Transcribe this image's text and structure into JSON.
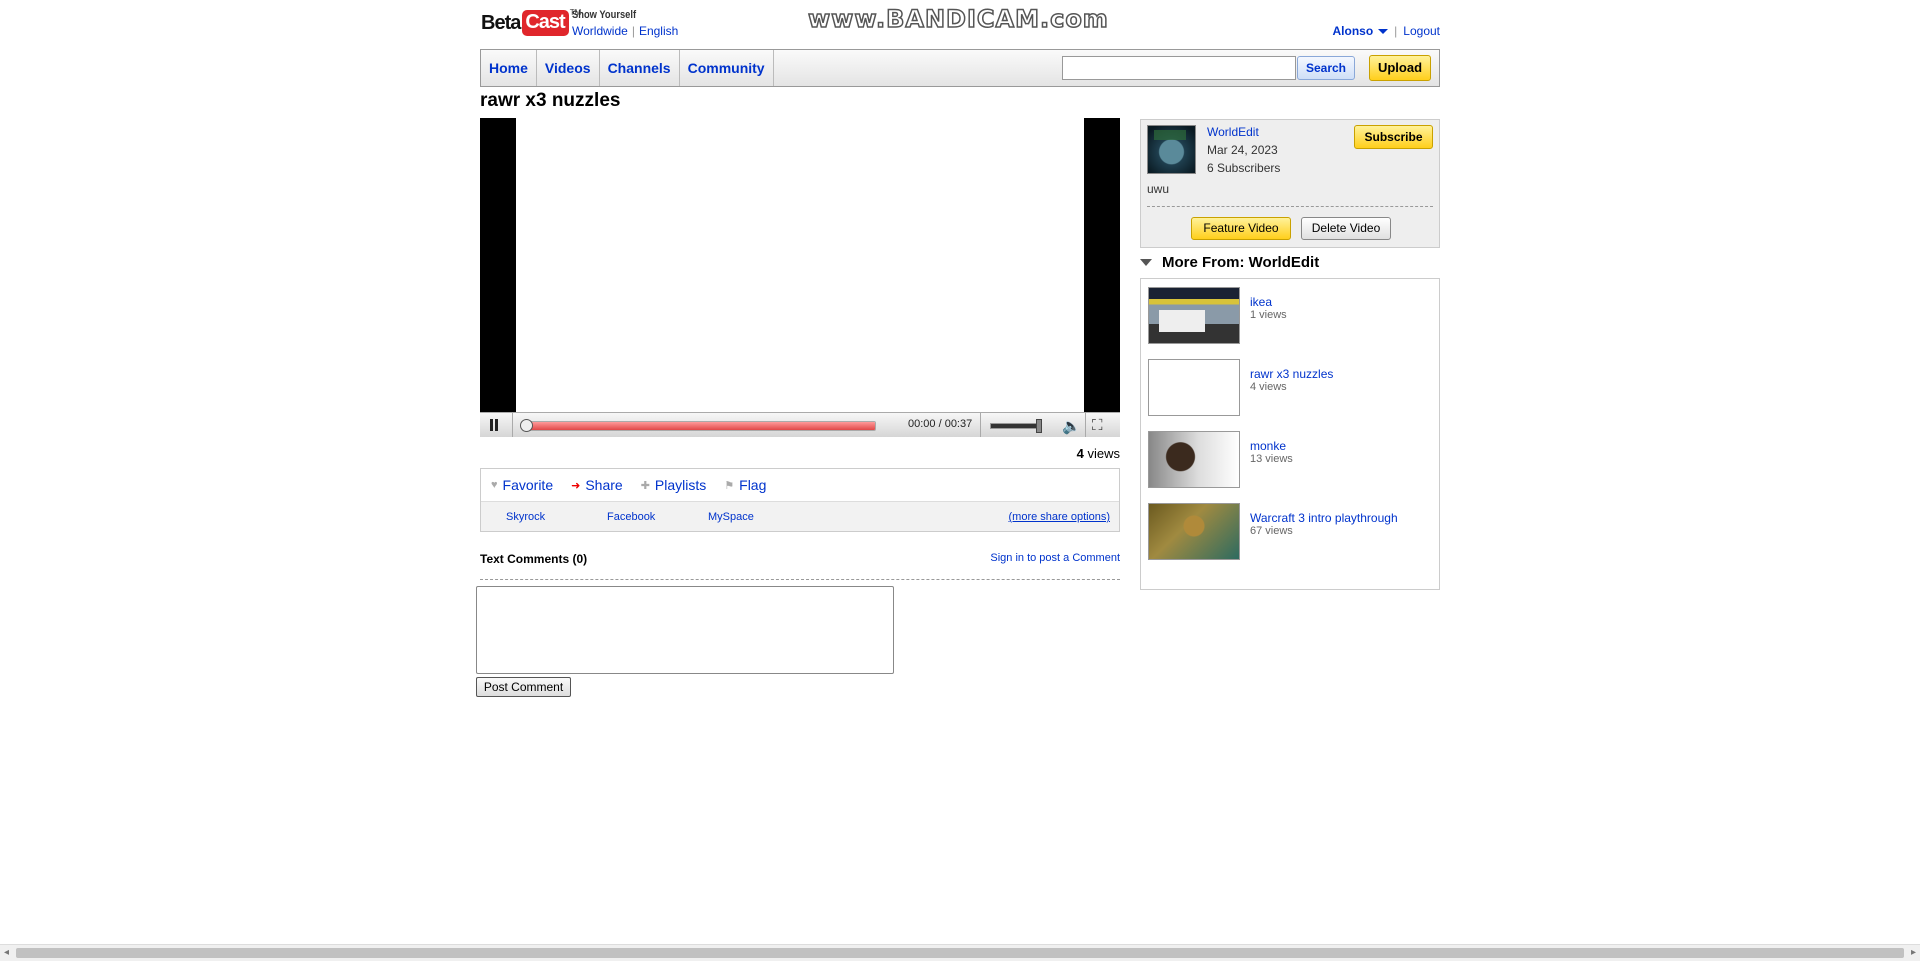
{
  "brand": {
    "beta": "Beta",
    "cast": "Cast",
    "tm": "TM",
    "tagline": "Show Yourself"
  },
  "locale": {
    "region": "Worldwide",
    "language": "English"
  },
  "watermark": "www.BANDICAM.com",
  "user": {
    "name": "Alonso",
    "logout": "Logout"
  },
  "nav": {
    "items": [
      "Home",
      "Videos",
      "Channels",
      "Community"
    ],
    "search_value": "",
    "search_label": "Search",
    "upload_label": "Upload"
  },
  "video": {
    "title": "rawr x3 nuzzles",
    "time": "00:00 / 00:37",
    "progress_fraction": 0.0,
    "views_count": "4",
    "views_label": "views"
  },
  "actions": {
    "favorite": "Favorite",
    "share": "Share",
    "playlists": "Playlists",
    "flag": "Flag"
  },
  "share": {
    "skyrock": "Skyrock",
    "facebook": "Facebook",
    "myspace": "MySpace",
    "more": "(more share options)"
  },
  "comments": {
    "heading": "Text Comments (0)",
    "signin": "Sign in to post a Comment",
    "post_label": "Post Comment"
  },
  "channel": {
    "name": "WorldEdit",
    "date": "Mar 24, 2023",
    "subscribers": "6 Subscribers",
    "description": "uwu",
    "subscribe_label": "Subscribe",
    "feature_label": "Feature Video",
    "delete_label": "Delete Video"
  },
  "more_from": {
    "heading": "More From: WorldEdit",
    "videos": [
      {
        "title": "ikea",
        "views": "1 views"
      },
      {
        "title": "rawr x3 nuzzles",
        "views": "4 views"
      },
      {
        "title": "monke",
        "views": "13 views"
      },
      {
        "title": "Warcraft 3 intro playthrough",
        "views": "67 views"
      }
    ]
  },
  "colors": {
    "accent_link": "#0033cc",
    "brand_red": "#e0262b",
    "yellow_button": "#ffcf1c",
    "progress_red": "#e04848"
  }
}
